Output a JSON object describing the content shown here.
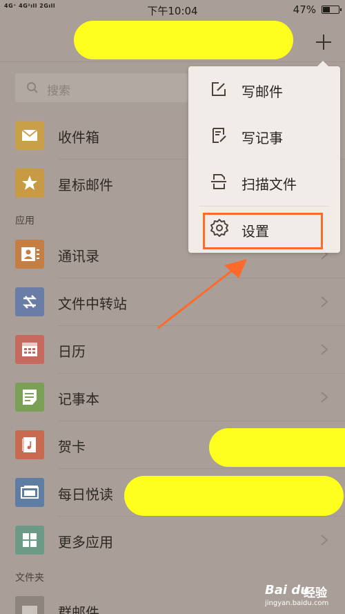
{
  "status_bar": {
    "signal": "4G⁺ 4G²ıll 2Gıll",
    "time": "下午10:04",
    "battery": "47%",
    "battery_level": 0.47
  },
  "header": {
    "add_icon": "plus-icon"
  },
  "search": {
    "placeholder": "搜索"
  },
  "mail_items": [
    {
      "label": "收件箱",
      "icon": "inbox-icon",
      "color": "#c9a04a"
    },
    {
      "label": "星标邮件",
      "icon": "star-icon",
      "color": "#c99a46"
    }
  ],
  "apps_section": "应用",
  "app_items": [
    {
      "label": "通讯录",
      "icon": "contacts-icon",
      "color": "#c57f45"
    },
    {
      "label": "文件中转站",
      "icon": "transfer-icon",
      "color": "#6a7da7"
    },
    {
      "label": "日历",
      "icon": "calendar-icon",
      "color": "#c66a60"
    },
    {
      "label": "记事本",
      "icon": "notes-icon",
      "color": "#79a055"
    },
    {
      "label": "贺卡",
      "icon": "card-icon",
      "color": "#c76a50"
    },
    {
      "label": "每日悦读",
      "icon": "reading-icon",
      "color": "#5f7da3"
    },
    {
      "label": "更多应用",
      "icon": "more-apps-icon",
      "color": "#6d9a86"
    }
  ],
  "folders_section": "文件夹",
  "folder_items": [
    {
      "label": "群邮件",
      "icon": "group-mail-icon",
      "color": "#8d847e"
    }
  ],
  "popup_menu": {
    "items": [
      {
        "label": "写邮件",
        "icon": "compose-icon"
      },
      {
        "label": "写记事",
        "icon": "write-note-icon"
      },
      {
        "label": "扫描文件",
        "icon": "scan-icon"
      },
      {
        "label": "设置",
        "icon": "gear-icon"
      }
    ],
    "highlight_color": "#ff6a2a"
  },
  "watermark": {
    "brand": "Bai du",
    "brand_cn": "经验",
    "url": "jingyan.baidu.com"
  },
  "colors": {
    "overlay": "#a99f98",
    "redaction": "#ffff1e",
    "annotation": "#ff6a2a"
  }
}
